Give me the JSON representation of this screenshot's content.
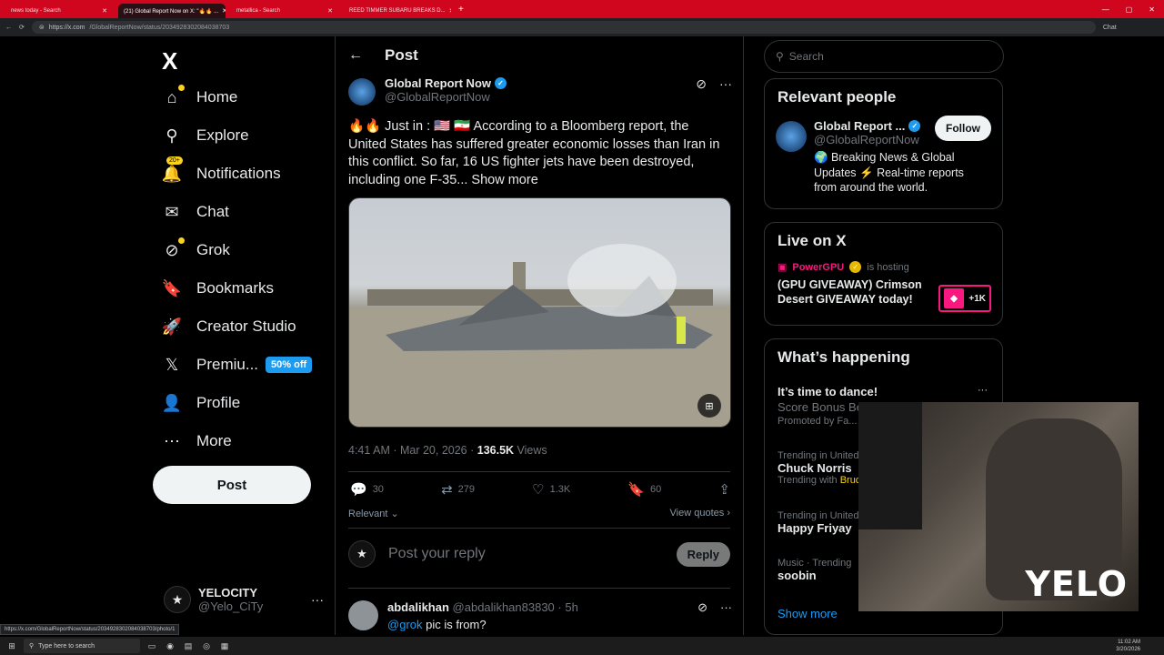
{
  "browser": {
    "tabs": [
      {
        "label": "news today - Search",
        "active": false
      },
      {
        "label": "(21) Global Report Now on X: \"🔥🔥 ...",
        "active": true
      },
      {
        "label": "metallica - Search",
        "active": false
      },
      {
        "label": "REED TIMMER SUBARU BREAKS D...",
        "active": false
      }
    ],
    "url_host": "https://x.com",
    "url_path": "/GlobalReportNow/status/2034928302084038703",
    "profile_label": "Chat",
    "status_url": "https://x.com/GlobalReportNow/status/2034928302084038703/photo/1"
  },
  "sidebar": {
    "logo": "X",
    "items": [
      {
        "label": "Home",
        "icon": "home-icon",
        "glyph": "⌂"
      },
      {
        "label": "Explore",
        "icon": "search-icon",
        "glyph": "⚲"
      },
      {
        "label": "Notifications",
        "icon": "bell-icon",
        "glyph": "🔔",
        "badge": "20+"
      },
      {
        "label": "Chat",
        "icon": "mail-icon",
        "glyph": "✉"
      },
      {
        "label": "Grok",
        "icon": "grok-icon",
        "glyph": "⊘"
      },
      {
        "label": "Bookmarks",
        "icon": "bookmark-icon",
        "glyph": "🔖"
      },
      {
        "label": "Creator Studio",
        "icon": "rocket-icon",
        "glyph": "🚀"
      },
      {
        "label": "Premiu...",
        "icon": "x-premium-icon",
        "glyph": "𝕏",
        "badge": "50% off"
      },
      {
        "label": "Profile",
        "icon": "person-icon",
        "glyph": "👤"
      },
      {
        "label": "More",
        "icon": "more-circle-icon",
        "glyph": "⋯"
      }
    ],
    "post_button": "Post",
    "account": {
      "name": "YELOCITY",
      "handle": "@Yelo_CiTy",
      "more": "···"
    }
  },
  "main": {
    "header_title": "Post",
    "author": {
      "name": "Global Report Now",
      "handle": "@GlobalReportNow"
    },
    "text": "🔥🔥 Just in : 🇺🇸 🇮🇷 According to a Bloomberg report, the United States has suffered greater economic losses than Iran in this conflict. So far, 16 US fighter jets have been destroyed, including one F-35...",
    "show_more": "Show more",
    "time": "4:41 AM · Mar 20, 2026 · ",
    "views_count": "136.5K",
    "views_label": " Views",
    "actions": {
      "replies": "30",
      "reposts": "279",
      "likes": "1.3K",
      "bookmarks": "60"
    },
    "sort_label": "Relevant ⌄",
    "view_quotes": "View quotes ›",
    "reply_placeholder": "Post your reply",
    "reply_button": "Reply",
    "comment": {
      "name": "abdalikhan",
      "handle": "@abdalikhan83830 · 5h",
      "mention": "@grok",
      "text": " pic is from?"
    }
  },
  "right": {
    "search_placeholder": "Search",
    "relevant_title": "Relevant people",
    "person": {
      "name": "Global Report ...",
      "handle": "@GlobalReportNow",
      "follow": "Follow",
      "bio": "🌍 Breaking News & Global Updates ⚡ Real-time reports from around the world."
    },
    "live_title": "Live on X",
    "live": {
      "host": "PowerGPU",
      "hosting": "is hosting",
      "title": "(GPU GIVEAWAY) Crimson Desert GIVEAWAY today!",
      "count": "+1K"
    },
    "happening_title": "What’s happening",
    "trends": [
      {
        "context": "It’s time to dance!",
        "line2": "Score Bonus Be...",
        "line3": "Promoted by Fa..."
      },
      {
        "context": "Trending in United...",
        "title": "Chuck Norris",
        "line2": "Trending with ",
        "line2b": "Bruc..."
      },
      {
        "context": "Trending in United...",
        "title": "Happy Friyay"
      },
      {
        "context": "Music · Trending",
        "title": "soobin"
      }
    ],
    "show_more": "Show more"
  },
  "webcam": {
    "brand": "YELO"
  },
  "taskbar": {
    "search_placeholder": "Type here to search",
    "time": "11:02 AM",
    "date": "3/20/2026"
  }
}
